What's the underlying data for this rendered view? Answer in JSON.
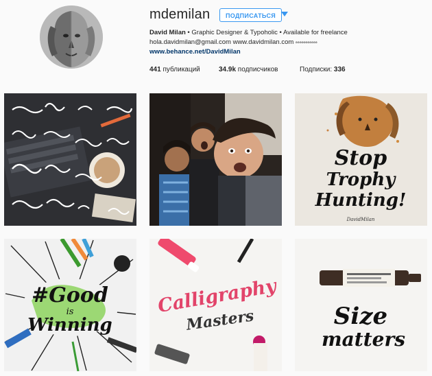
{
  "profile": {
    "username": "mdemilan",
    "follow_label": "ПОДПИСАТЬСЯ",
    "more_icon": "triangle-down-icon",
    "bio": {
      "name": "David Milan",
      "tagline": " • Graphic Designer & Typoholic • Available for freelance ",
      "contact": "hola.davidmilan@gmail.com www.davidmilan.com ",
      "contact_extra": "𝇇𝇇𝇇𝇇𝇇𝇇𝇇𝇇𝇇𝇇𝇇",
      "website": "www.behance.net/DavidMilan"
    },
    "stats": {
      "posts_count": "441",
      "posts_label": " публикаций",
      "followers_count": "34.9k",
      "followers_label": " подписчиков",
      "following_label": "Подписки: ",
      "following_count": "336"
    }
  },
  "posts": [
    {
      "alt": "lettering collection on desk"
    },
    {
      "alt": "group selfie"
    },
    {
      "alt": "Stop Trophy Hunting lion",
      "text": [
        "Stop",
        "Trophy",
        "Hunting!"
      ],
      "signature": "DavidMilan"
    },
    {
      "alt": "Good is Winning",
      "text": [
        "#Good",
        "is",
        "Winning"
      ]
    },
    {
      "alt": "Calligraphy Masters",
      "text": [
        "Calligraphy",
        "Masters"
      ]
    },
    {
      "alt": "Size matters",
      "text": [
        "Size",
        "matters"
      ]
    }
  ]
}
